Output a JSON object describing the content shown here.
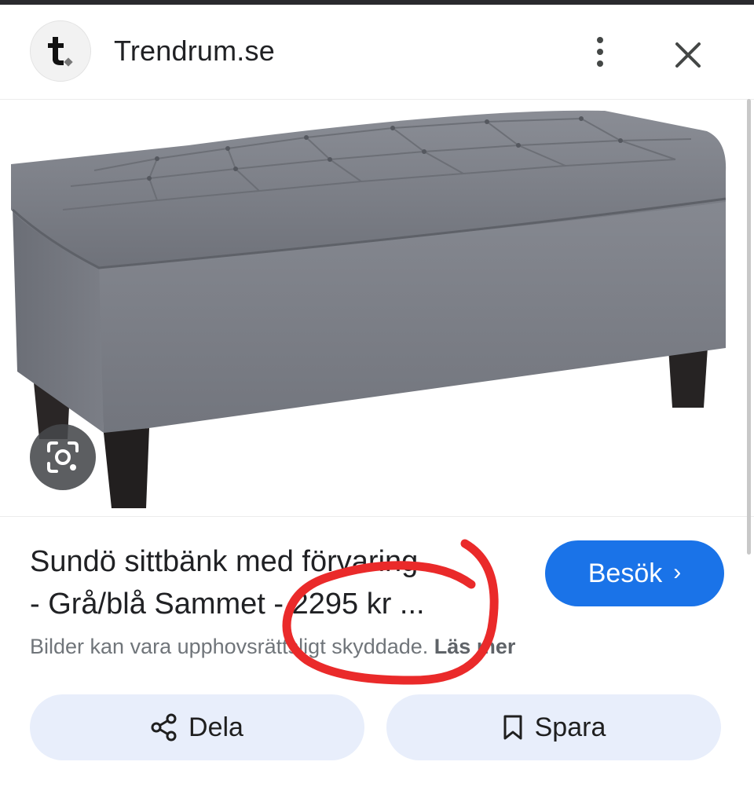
{
  "header": {
    "logo_letter": "t.",
    "site_name": "Trendrum.se",
    "more_icon": "more-vert-icon",
    "close_icon": "close-icon"
  },
  "image": {
    "description_icon": "google-lens-icon"
  },
  "result": {
    "title_line1": "Sundö sittbänk med förvaring",
    "title_line2": "- Grå/blå Sammet - 2295 kr ...",
    "copyright_notice": "Bilder kan vara upphovsrättsligt skyddade.",
    "read_more": "Läs mer"
  },
  "buttons": {
    "visit_label": "Besök",
    "visit_chevron": "›",
    "share_label": "Dela",
    "save_label": "Spara"
  },
  "colors": {
    "visit_button": "#1a73e8",
    "action_button_bg": "#e8eefb",
    "annotation_circle": "#ea2a2a",
    "bench_fabric": "#7c7f87"
  }
}
